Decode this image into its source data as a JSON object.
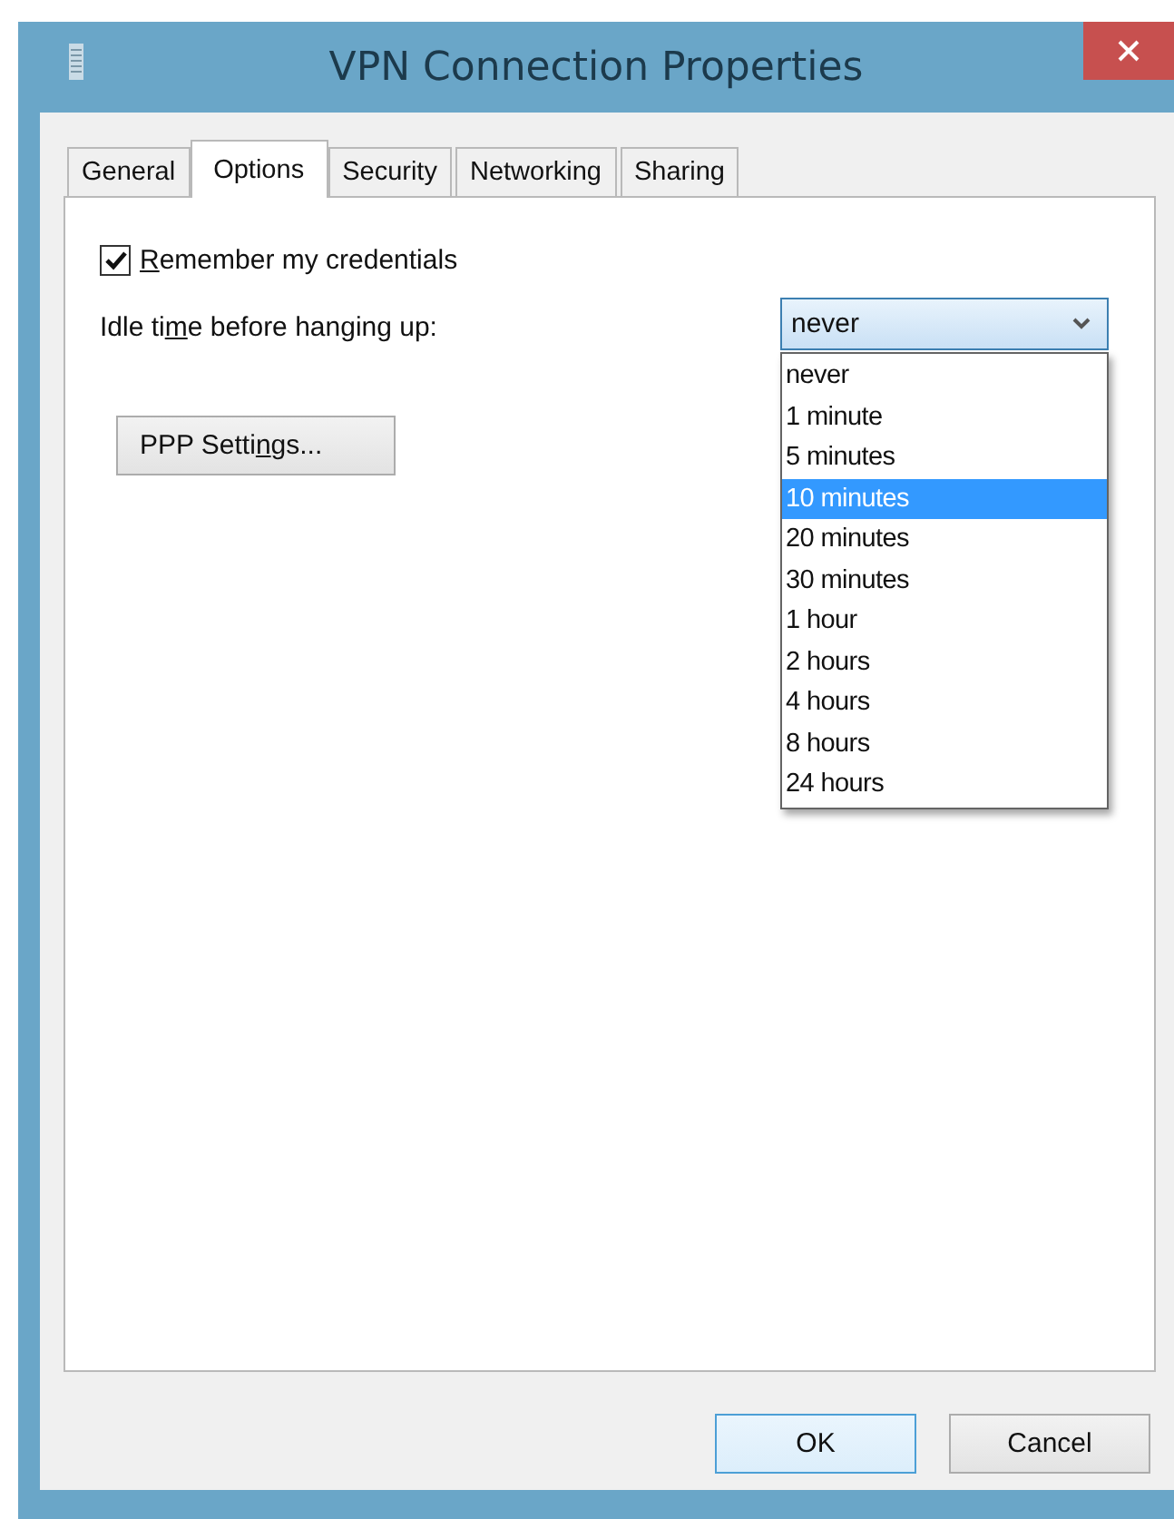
{
  "window": {
    "title": "VPN Connection Properties"
  },
  "tabs": [
    {
      "label": "General",
      "selected": false
    },
    {
      "label": "Options",
      "selected": true
    },
    {
      "label": "Security",
      "selected": false
    },
    {
      "label": "Networking",
      "selected": false
    },
    {
      "label": "Sharing",
      "selected": false
    }
  ],
  "remember_credentials": {
    "label": {
      "key": "R",
      "post": "emember my credentials"
    },
    "checked": true
  },
  "idle_time": {
    "label": {
      "pre": "Idle ti",
      "key": "m",
      "post": "e before hanging up:"
    },
    "value": "never",
    "expanded": true,
    "options": [
      {
        "label": "never",
        "highlighted": false
      },
      {
        "label": "1 minute",
        "highlighted": false
      },
      {
        "label": "5 minutes",
        "highlighted": false
      },
      {
        "label": "10 minutes",
        "highlighted": true
      },
      {
        "label": "20 minutes",
        "highlighted": false
      },
      {
        "label": "30 minutes",
        "highlighted": false
      },
      {
        "label": "1 hour",
        "highlighted": false
      },
      {
        "label": "2 hours",
        "highlighted": false
      },
      {
        "label": "4 hours",
        "highlighted": false
      },
      {
        "label": "8 hours",
        "highlighted": false
      },
      {
        "label": "24 hours",
        "highlighted": false
      }
    ]
  },
  "ppp_button": {
    "label": {
      "pre": "PPP Setti",
      "key": "n",
      "post": "gs..."
    }
  },
  "buttons": [
    {
      "label": "OK",
      "kind": "default"
    },
    {
      "label": "Cancel",
      "kind": "normal"
    }
  ]
}
